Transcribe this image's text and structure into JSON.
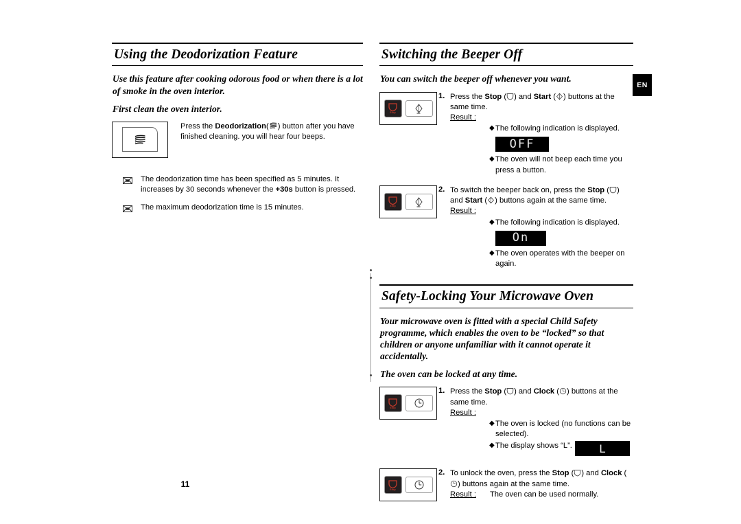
{
  "page": {
    "number": "11",
    "language_tab": "EN"
  },
  "left_column": {
    "section": {
      "title": "Using the Deodorization Feature",
      "intro_1": "Use this feature after cooking odorous food or when there is a lot of smoke in the oven interior.",
      "intro_2": "First clean the oven interior.",
      "illustration": {
        "icon_name": "deodorization-waves-icon"
      },
      "instruction": {
        "prefix": "Press the ",
        "bold": "Deodorization",
        "paren_open": "(",
        "paren_close": ")",
        "suffix": " button after you have finished cleaning. you will hear four beeps.",
        "icon_name": "deodorization-waves-icon"
      },
      "notes": [
        {
          "icon_name": "note-envelope-icon",
          "text_before": "The deodorization time has been specified as 5 minutes. It increases by 30 seconds whenever the ",
          "bold": "+30s",
          "text_after": " button is pressed."
        },
        {
          "icon_name": "note-envelope-icon",
          "text_before": "The maximum deodorization time is 15 minutes.",
          "bold": "",
          "text_after": ""
        }
      ]
    }
  },
  "right_column": {
    "beeper_section": {
      "title": "Switching the Beeper Off",
      "intro": "You can switch the beeper off whenever you want.",
      "steps": [
        {
          "number": "1.",
          "panel": {
            "stop_label": "Stop",
            "second_key": "start-key"
          },
          "text_part_1": "Press the ",
          "bold_1": "Stop",
          "text_part_2": " (",
          "text_part_3": ") and ",
          "bold_2": "Start",
          "text_part_4": " (",
          "text_part_5": ") buttons at the same time.",
          "result_label": "Result :",
          "results": [
            {
              "text": "The following indication is displayed."
            },
            {
              "text": "The oven will not beep each time you press a button."
            }
          ],
          "display": "OFF"
        },
        {
          "number": "2.",
          "panel": {
            "stop_label": "Stop",
            "second_key": "start-key"
          },
          "text_part_1": "To switch the beeper back on, press the ",
          "bold_1": "Stop",
          "text_part_2": " (",
          "text_part_3": ") and ",
          "bold_2": "Start",
          "text_part_4": " (",
          "text_part_5": ") buttons again at the same time.",
          "result_label": "Result :",
          "results": [
            {
              "text": "The following indication is displayed."
            },
            {
              "text": "The oven operates with the beeper on again."
            }
          ],
          "display": "On"
        }
      ]
    },
    "safety_section": {
      "title": "Safety-Locking Your Microwave Oven",
      "intro_1": "Your microwave oven is fitted with a special Child Safety programme, which enables the oven to be “locked” so that children or anyone unfamiliar with it cannot operate it accidentally.",
      "intro_2": "The oven can be locked at any time.",
      "steps": [
        {
          "number": "1.",
          "panel": {
            "stop_label": "Stop",
            "second_key": "clock-key"
          },
          "text_part_1": "Press the ",
          "bold_1": "Stop",
          "text_part_2": " (",
          "text_part_3": ") and ",
          "bold_2": "Clock",
          "text_part_4": " (",
          "text_part_5": ") buttons at the same time.",
          "result_label": "Result :",
          "results": [
            {
              "text": "The oven is locked (no functions can be selected)."
            },
            {
              "text": "The display shows “L”."
            }
          ],
          "display": "L"
        },
        {
          "number": "2.",
          "panel": {
            "stop_label": "Stop",
            "second_key": "clock-key"
          },
          "text_part_1": "To unlock the oven, press the ",
          "bold_1": "Stop",
          "text_part_2": " (",
          "text_part_3": ") and ",
          "bold_2": "Clock",
          "text_part_4": " (",
          "text_part_5": ") buttons again at the same time.",
          "result_label": "Result :",
          "result_inline": "The oven can be used normally."
        }
      ]
    }
  },
  "colors": {
    "led_background": "#000000",
    "led_text": "#e9e9e9",
    "stop_key_background": "#231f20",
    "stop_key_red": "#c0392b",
    "rule": "#000000"
  }
}
